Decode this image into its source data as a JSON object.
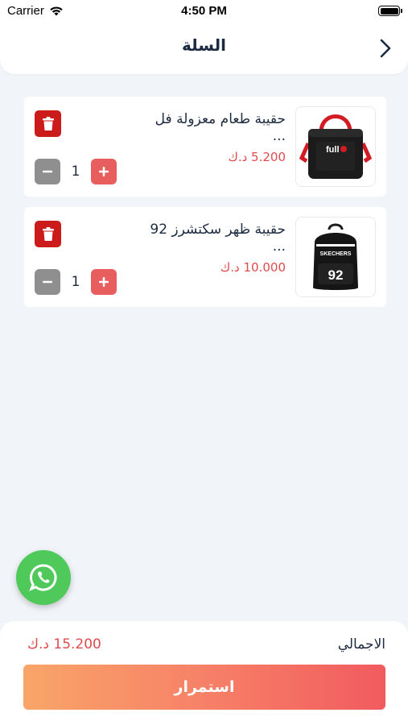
{
  "status_bar": {
    "carrier": "Carrier",
    "time": "4:50 PM"
  },
  "header": {
    "title": "السلة",
    "back_icon": "chevron-right-icon"
  },
  "cart": {
    "items": [
      {
        "name": "حقيبة طعام معزولة فل ...",
        "price": "5.200 د.ك",
        "quantity": "1",
        "image_label": "full"
      },
      {
        "name": "حقيبة ظهر سكتشرز 92 ...",
        "price": "10.000 د.ك",
        "quantity": "1",
        "image_label": "SKECHERS",
        "image_number": "92"
      }
    ]
  },
  "whatsapp": {
    "icon": "whatsapp-icon"
  },
  "footer": {
    "total_label": "الاجمالي",
    "total_value": "15.200 د.ك",
    "continue_label": "استمرار"
  },
  "colors": {
    "accent_red": "#e04b4b",
    "delete_red": "#cc1b1b",
    "plus_red": "#e85d5d",
    "minus_gray": "#8f8f8f",
    "whatsapp_green": "#4ec95a",
    "gradient_start": "#f9a569",
    "gradient_end": "#f15b5e"
  }
}
